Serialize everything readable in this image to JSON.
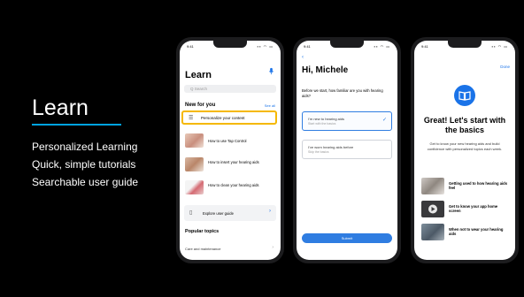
{
  "slide": {
    "title": "Learn",
    "accent_color": "#00a3e0",
    "bullets": [
      "Personalized Learning",
      "Quick, simple tutorials",
      "Searchable user guide"
    ]
  },
  "phone1": {
    "status_time": "9:41",
    "title": "Learn",
    "search_placeholder": "Q Search",
    "section_title": "New for you",
    "see_all": "See all",
    "highlight_color": "#f5b800",
    "personalize_label": "Personalize your content",
    "items": [
      {
        "label": "How to use Tap Control",
        "icon": "hand-ear-thumbnail"
      },
      {
        "label": "How to insert your hearing aids",
        "icon": "insert-hearing-aid-thumbnail"
      },
      {
        "label": "How to clean your hearing aids",
        "icon": "clean-hearing-aid-thumbnail"
      }
    ],
    "explore_label": "Explore user guide",
    "popular_title": "Popular topics",
    "care_label": "Care and maintenance"
  },
  "phone2": {
    "status_time": "9:41",
    "greeting": "Hi, Michele",
    "question": "Before we start, how familiar are you with hearing aids?",
    "options": [
      {
        "title": "I'm new to hearing aids",
        "subtitle": "Start with the basics",
        "selected": true
      },
      {
        "title": "I've worn hearing aids before",
        "subtitle": "Skip the basics",
        "selected": false
      }
    ],
    "submit_label": "Submit",
    "accent": "#2f7de1"
  },
  "phone3": {
    "status_time": "9:41",
    "done_label": "Done",
    "headline": "Great! Let's start with the basics",
    "description": "Get to know your new hearing aids and build confidence with personalized topics each week.",
    "items": [
      {
        "label": "Getting used to how hearing aids feel",
        "icon": "woman-thumbnail"
      },
      {
        "label": "Get to know your app home screen",
        "icon": "video-play-thumbnail"
      },
      {
        "label": "When not to wear your hearing aids",
        "icon": "man-thumbnail"
      }
    ],
    "accent": "#1a73e8"
  }
}
